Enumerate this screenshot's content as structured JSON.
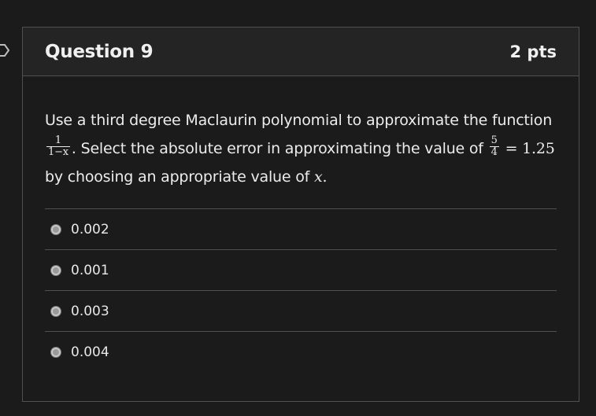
{
  "question": {
    "title": "Question 9",
    "points": "2 pts",
    "text_1": "Use a third degree Maclaurin polynomial to approximate the function",
    "func_num": "1",
    "func_den": "1−x",
    "text_2": ". Select the absolute error in approximating the value of",
    "val_num": "5",
    "val_den": "4",
    "equals": "= 1.25",
    "text_3": "by choosing an appropriate value of",
    "var": "x",
    "text_4": "."
  },
  "answers": [
    {
      "label": "0.002"
    },
    {
      "label": "0.001"
    },
    {
      "label": "0.003"
    },
    {
      "label": "0.004"
    }
  ]
}
